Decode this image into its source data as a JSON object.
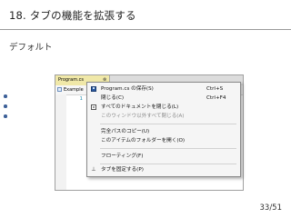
{
  "slide": {
    "title": "18. タブの機能を拡張する",
    "subtitle": "デフォルト",
    "page_number": "33/51"
  },
  "ide": {
    "tab_label": "Program.cs",
    "tab_close": "⊗",
    "nav_label": "Example",
    "line_number": "1"
  },
  "menu": {
    "items": [
      {
        "label": "Program.cs の保存(S)",
        "shortcut": "Ctrl+S",
        "icon": "save-icon",
        "enabled": true
      },
      {
        "label": "閉じる(C)",
        "shortcut": "Ctrl+F4",
        "enabled": true
      },
      {
        "label": "すべてのドキュメントを閉じる(L)",
        "shortcut": "",
        "icon": "close-all-icon",
        "enabled": true
      },
      {
        "label": "このウィンドウ以外すべて閉じる(A)",
        "shortcut": "",
        "enabled": false
      },
      {
        "label": "完全パスのコピー(U)",
        "shortcut": "",
        "enabled": true
      },
      {
        "label": "このアイテムのフォルダーを開く(O)",
        "shortcut": "",
        "enabled": true
      },
      {
        "label": "フローティング(F)",
        "shortcut": "",
        "enabled": true
      },
      {
        "label": "タブを固定する(P)",
        "shortcut": "",
        "icon": "pin-icon",
        "enabled": true
      }
    ]
  },
  "colors": {
    "accent": "#3d6098",
    "title_rule": "#9a9a9a"
  }
}
